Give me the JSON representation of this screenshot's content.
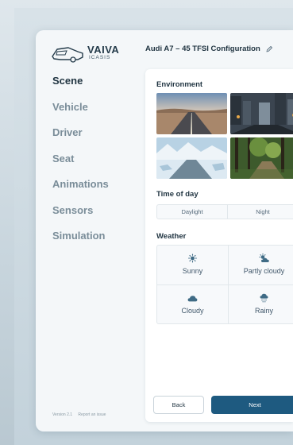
{
  "app": {
    "logo_brand": "VAIVA",
    "logo_sub": "ICASIS",
    "title": "Audi A7 – 45 TFSI Configuration"
  },
  "sidebar": {
    "items": [
      {
        "label": "Scene",
        "active": true
      },
      {
        "label": "Vehicle",
        "active": false
      },
      {
        "label": "Driver",
        "active": false
      },
      {
        "label": "Seat",
        "active": false
      },
      {
        "label": "Animations",
        "active": false
      },
      {
        "label": "Sensors",
        "active": false
      },
      {
        "label": "Simulation",
        "active": false
      }
    ]
  },
  "footer": {
    "version": "Version 2.1",
    "report": "Report an issue"
  },
  "panel": {
    "environment_label": "Environment",
    "environments": [
      {
        "icon": "desert-road-image"
      },
      {
        "icon": "city-street-image"
      },
      {
        "icon": "snowy-road-image"
      },
      {
        "icon": "forest-path-image"
      }
    ],
    "time_label": "Time of day",
    "time_options": [
      "Daylight",
      "Night"
    ],
    "weather_label": "Weather",
    "weather_options": [
      {
        "label": "Sunny",
        "icon": "sun-icon"
      },
      {
        "label": "Partly cloudy",
        "icon": "partly-cloudy-icon"
      },
      {
        "label": "Cloudy",
        "icon": "cloud-icon"
      },
      {
        "label": "Rainy",
        "icon": "rain-icon"
      }
    ],
    "back_label": "Back",
    "next_label": "Next"
  },
  "colors": {
    "accent": "#1e5a80",
    "text_dark": "#1f3340",
    "text_muted": "#7a8d99",
    "icon": "#3f6b85"
  }
}
